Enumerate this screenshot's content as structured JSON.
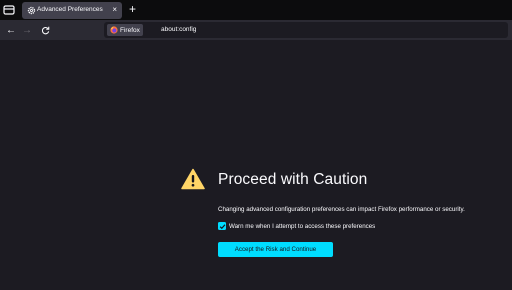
{
  "tab": {
    "title": "Advanced Preferences",
    "close": "×"
  },
  "new_tab": "+",
  "nav": {
    "back": "←",
    "forward": "→",
    "reload": "C"
  },
  "urlbar": {
    "identity": "Firefox",
    "url": "about:config"
  },
  "warning": {
    "title": "Proceed with Caution",
    "description": "Changing advanced configuration preferences can impact Firefox performance or security.",
    "checkbox_label": "Warn me when I attempt to access these preferences",
    "checkbox_checked": true,
    "accept_button": "Accept the Risk and Continue"
  },
  "colors": {
    "accent": "#00ddff",
    "warning": "#ffd567",
    "background": "#1c1b22"
  }
}
